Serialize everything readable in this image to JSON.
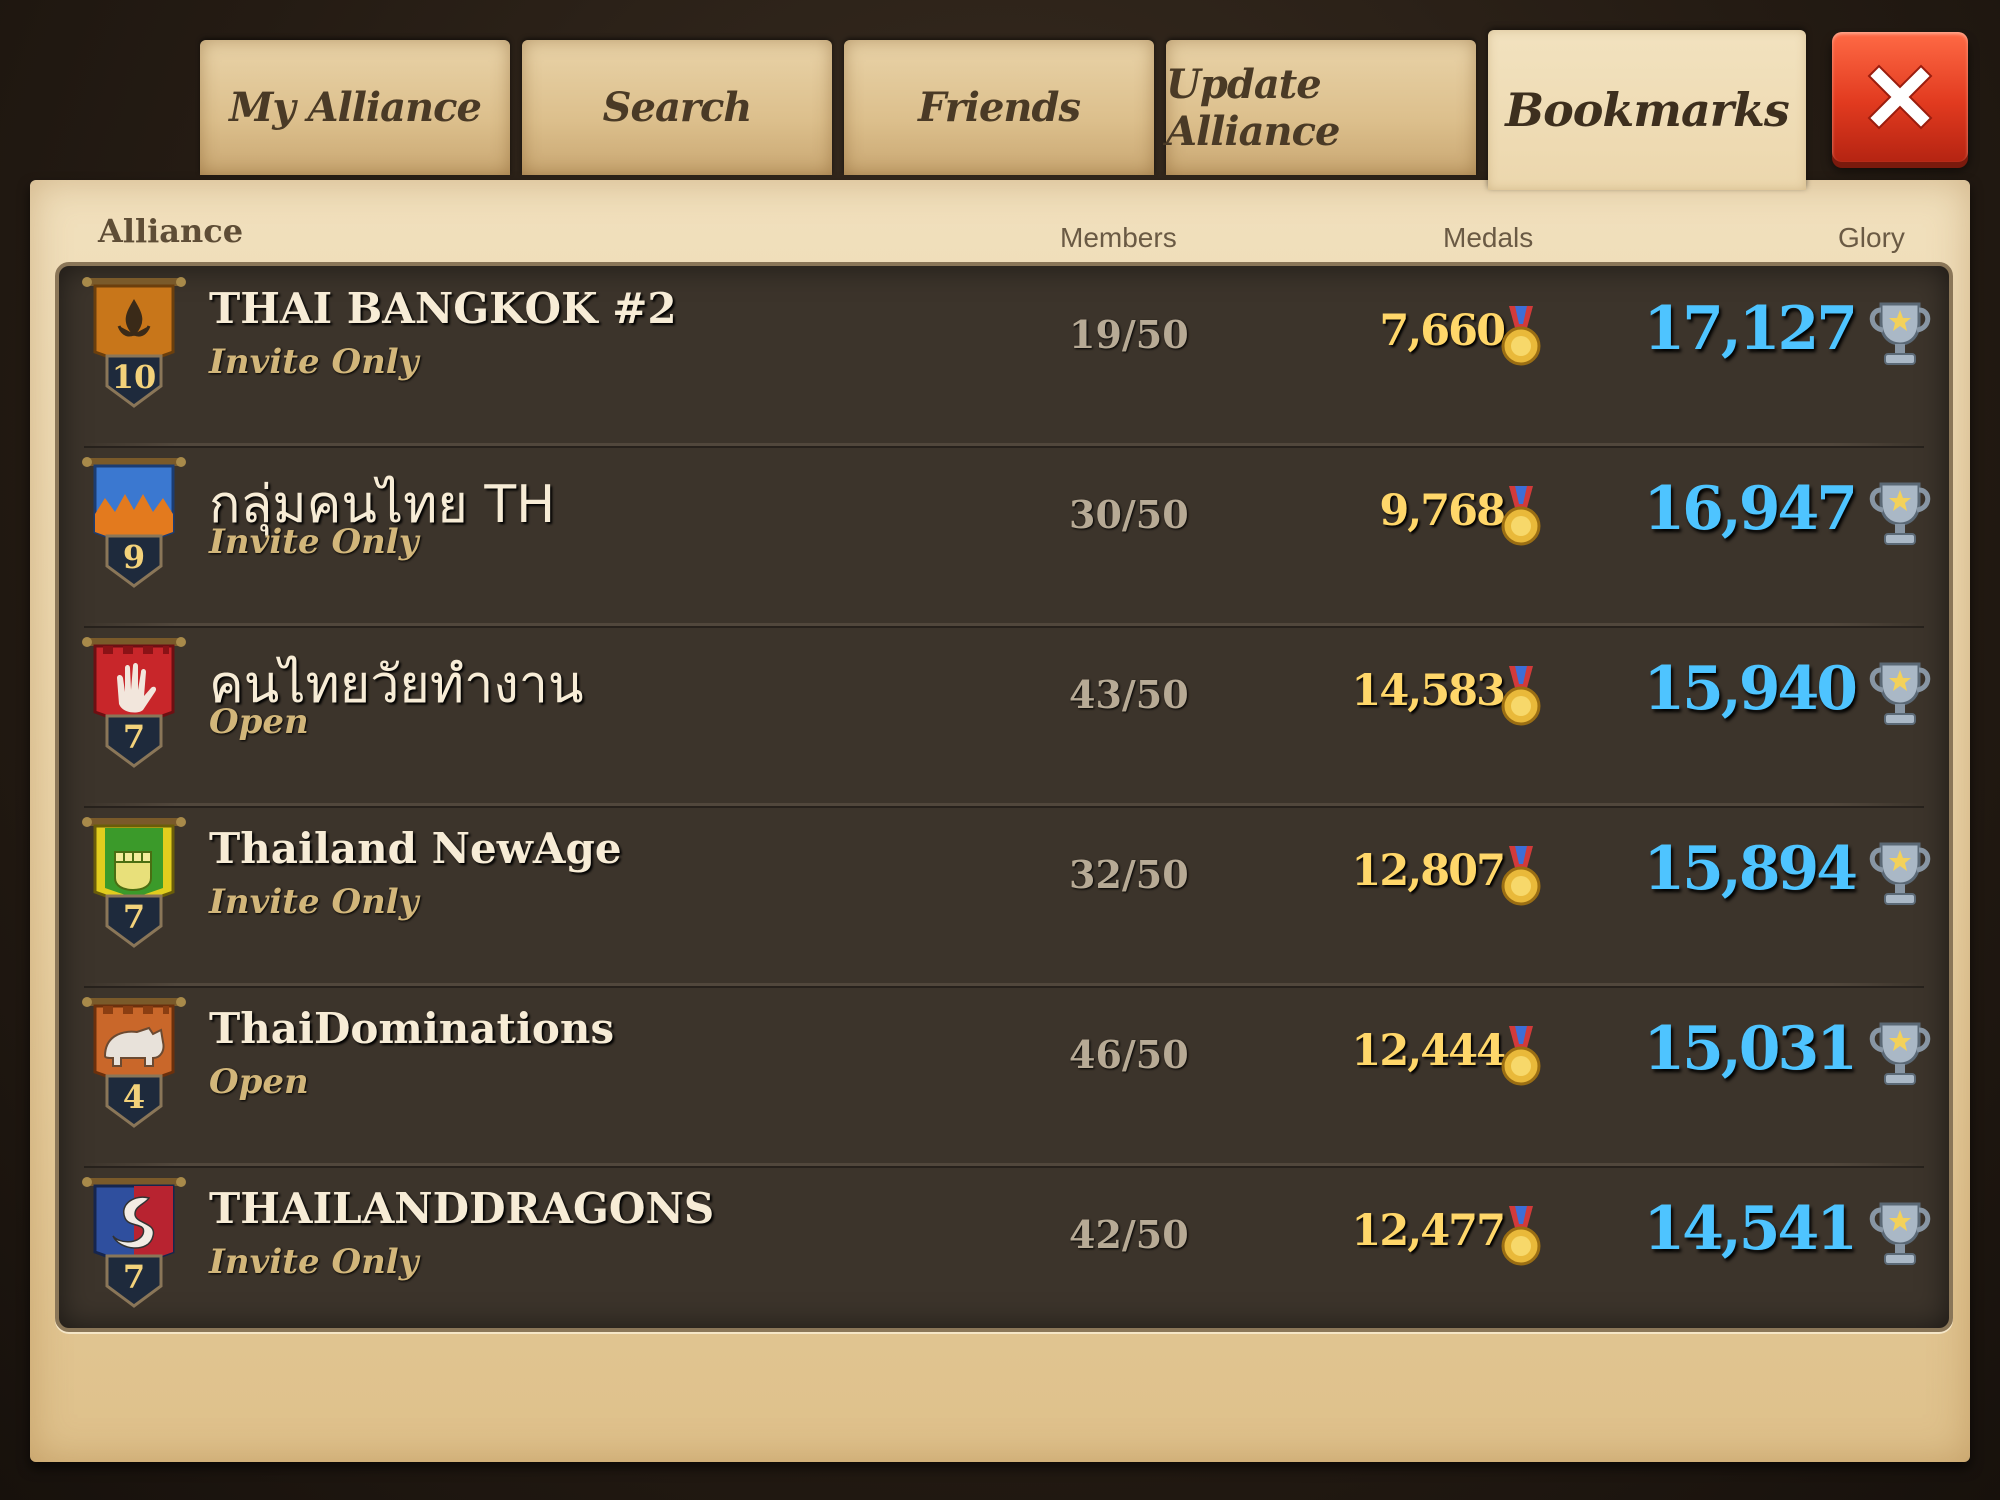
{
  "tabs": [
    {
      "label": "My Alliance",
      "active": false
    },
    {
      "label": "Search",
      "active": false
    },
    {
      "label": "Friends",
      "active": false
    },
    {
      "label": "Update Alliance",
      "active": false
    },
    {
      "label": "Bookmarks",
      "active": true
    }
  ],
  "close_icon": "close-x-icon",
  "headers": {
    "alliance": "Alliance",
    "members": "Members",
    "medals": "Medals",
    "glory": "Glory"
  },
  "colors": {
    "medals_text": "#ffd76a",
    "glory_text": "#4ec4ff",
    "close_button": "#e13a1f"
  },
  "rows": [
    {
      "name": "THAI BANGKOK #2",
      "status": "Invite Only",
      "level": "10",
      "members": "19/50",
      "medals": "7,660",
      "glory": "17,127",
      "emblem": "fleur-de-lis-banner-icon",
      "banner_color": "#c8761a"
    },
    {
      "name": "กลุ่มคนไทย TH",
      "status": "Invite Only",
      "level": "9",
      "members": "30/50",
      "medals": "9,768",
      "glory": "16,947",
      "emblem": "flame-banner-icon",
      "banner_color": "#3b78d0"
    },
    {
      "name": "คนไทยวัยทำงาน",
      "status": "Open",
      "level": "7",
      "members": "43/50",
      "medals": "14,583",
      "glory": "15,940",
      "emblem": "hand-banner-icon",
      "banner_color": "#c8262a"
    },
    {
      "name": "Thailand NewAge",
      "status": "Invite Only",
      "level": "7",
      "members": "32/50",
      "medals": "12,807",
      "glory": "15,894",
      "emblem": "fist-banner-icon",
      "banner_color": "#7fae1c"
    },
    {
      "name": "ThaiDominations",
      "status": "Open",
      "level": "4",
      "members": "46/50",
      "medals": "12,444",
      "glory": "15,031",
      "emblem": "rhino-banner-icon",
      "banner_color": "#c9672a"
    },
    {
      "name": "THAILANDDRAGONS",
      "status": "Invite Only",
      "level": "7",
      "members": "42/50",
      "medals": "12,477",
      "glory": "14,541",
      "emblem": "dragon-banner-icon",
      "banner_color": "#2f4f9e"
    }
  ]
}
